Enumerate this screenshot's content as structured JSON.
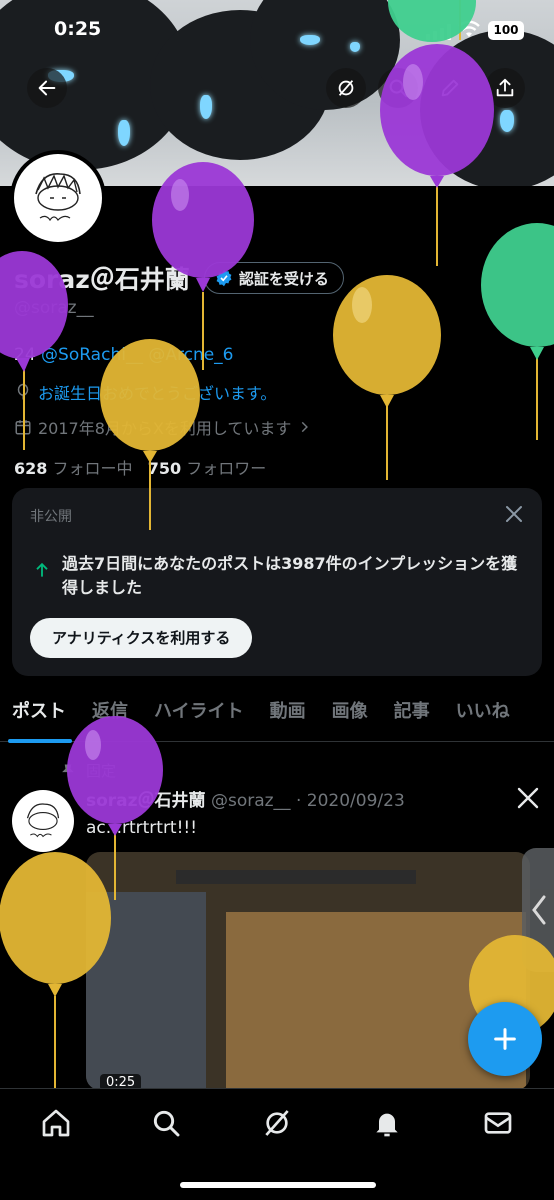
{
  "status_bar": {
    "time": "0:25",
    "battery": "100"
  },
  "profile": {
    "display_name": "soraz＠石井蘭",
    "verify_label": "認証を受ける",
    "handle": "@soraz__",
    "bio_prefix": "24",
    "bio_link1": "@SoRachi__",
    "bio_link2": "@Arcne_6",
    "birthday_text": "お誕生日おめでとうございます。",
    "joined_text": "2017年8月からXを利用しています",
    "following_count": "628",
    "following_label": "フォロー中",
    "followers_count": "750",
    "followers_label": "フォロワー"
  },
  "analytics_card": {
    "private_label": "非公開",
    "message": "過去7日間にあなたのポストは3987件のインプレッションを獲得しました",
    "cta_label": "アナリティクスを利用する"
  },
  "tabs": [
    {
      "label": "ポスト",
      "active": true
    },
    {
      "label": "返信"
    },
    {
      "label": "ハイライト"
    },
    {
      "label": "動画"
    },
    {
      "label": "画像"
    },
    {
      "label": "記事"
    },
    {
      "label": "いいね"
    }
  ],
  "post": {
    "pinned_label": "固定",
    "author_name": "soraz＠石井蘭",
    "author_handle": "@soraz__",
    "separator": "·",
    "date": "2020/09/23",
    "text": "ac...rtrtrtrt!!!",
    "video_duration": "0:25"
  },
  "colors": {
    "accent": "#1d9bf0",
    "balloon_purple": "#9b38d6",
    "balloon_gold": "#e3b634",
    "balloon_green": "#3fcf8e"
  },
  "icons": [
    "back-arrow-icon",
    "grok-icon",
    "search-icon",
    "edit-icon",
    "share-icon",
    "verified-badge-icon",
    "balloon-icon",
    "calendar-icon",
    "close-icon",
    "arrow-up-icon",
    "pin-icon",
    "x-logo-icon",
    "chevron-left-icon",
    "plus-icon",
    "home-icon",
    "notifications-icon",
    "messages-icon"
  ]
}
